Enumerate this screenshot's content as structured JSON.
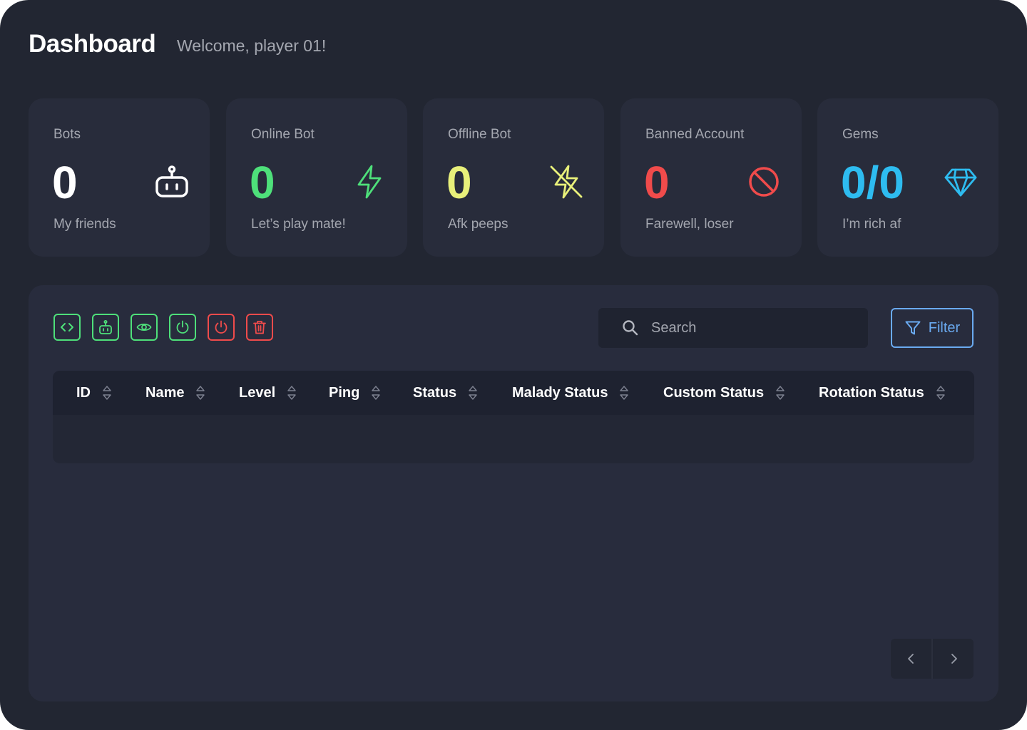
{
  "header": {
    "title": "Dashboard",
    "welcome": "Welcome, player 01!"
  },
  "stats": [
    {
      "label": "Bots",
      "value": "0",
      "subtitle": "My friends",
      "color": "#ffffff",
      "icon": "robot-icon"
    },
    {
      "label": "Online Bot",
      "value": "0",
      "subtitle": "Let’s play mate!",
      "color": "#4ee07a",
      "icon": "lightning-icon"
    },
    {
      "label": "Offline Bot",
      "value": "0",
      "subtitle": "Afk peeps",
      "color": "#e8f07a",
      "icon": "lightning-off-icon"
    },
    {
      "label": "Banned Account",
      "value": "0",
      "subtitle": "Farewell, loser",
      "color": "#f04b4b",
      "icon": "ban-icon"
    },
    {
      "label": "Gems",
      "value": "0/0",
      "subtitle": "I’m rich af",
      "color": "#2ebcf0",
      "icon": "diamond-icon"
    }
  ],
  "toolbar": {
    "actions": [
      {
        "icon": "code-icon",
        "color": "#4ee07a"
      },
      {
        "icon": "robot-icon",
        "color": "#4ee07a"
      },
      {
        "icon": "eye-icon",
        "color": "#4ee07a"
      },
      {
        "icon": "power-icon",
        "color": "#4ee07a"
      },
      {
        "icon": "power-icon",
        "color": "#f04b4b"
      },
      {
        "icon": "trash-icon",
        "color": "#f04b4b"
      }
    ],
    "search_placeholder": "Search",
    "search_value": "",
    "filter_label": "Filter",
    "filter_color": "#6aaaf0"
  },
  "table": {
    "columns": [
      "ID",
      "Name",
      "Level",
      "Ping",
      "Status",
      "Malady Status",
      "Custom Status",
      "Rotation Status"
    ],
    "rows": []
  },
  "pagination": {
    "prev_icon": "chevron-left-icon",
    "next_icon": "chevron-right-icon"
  }
}
